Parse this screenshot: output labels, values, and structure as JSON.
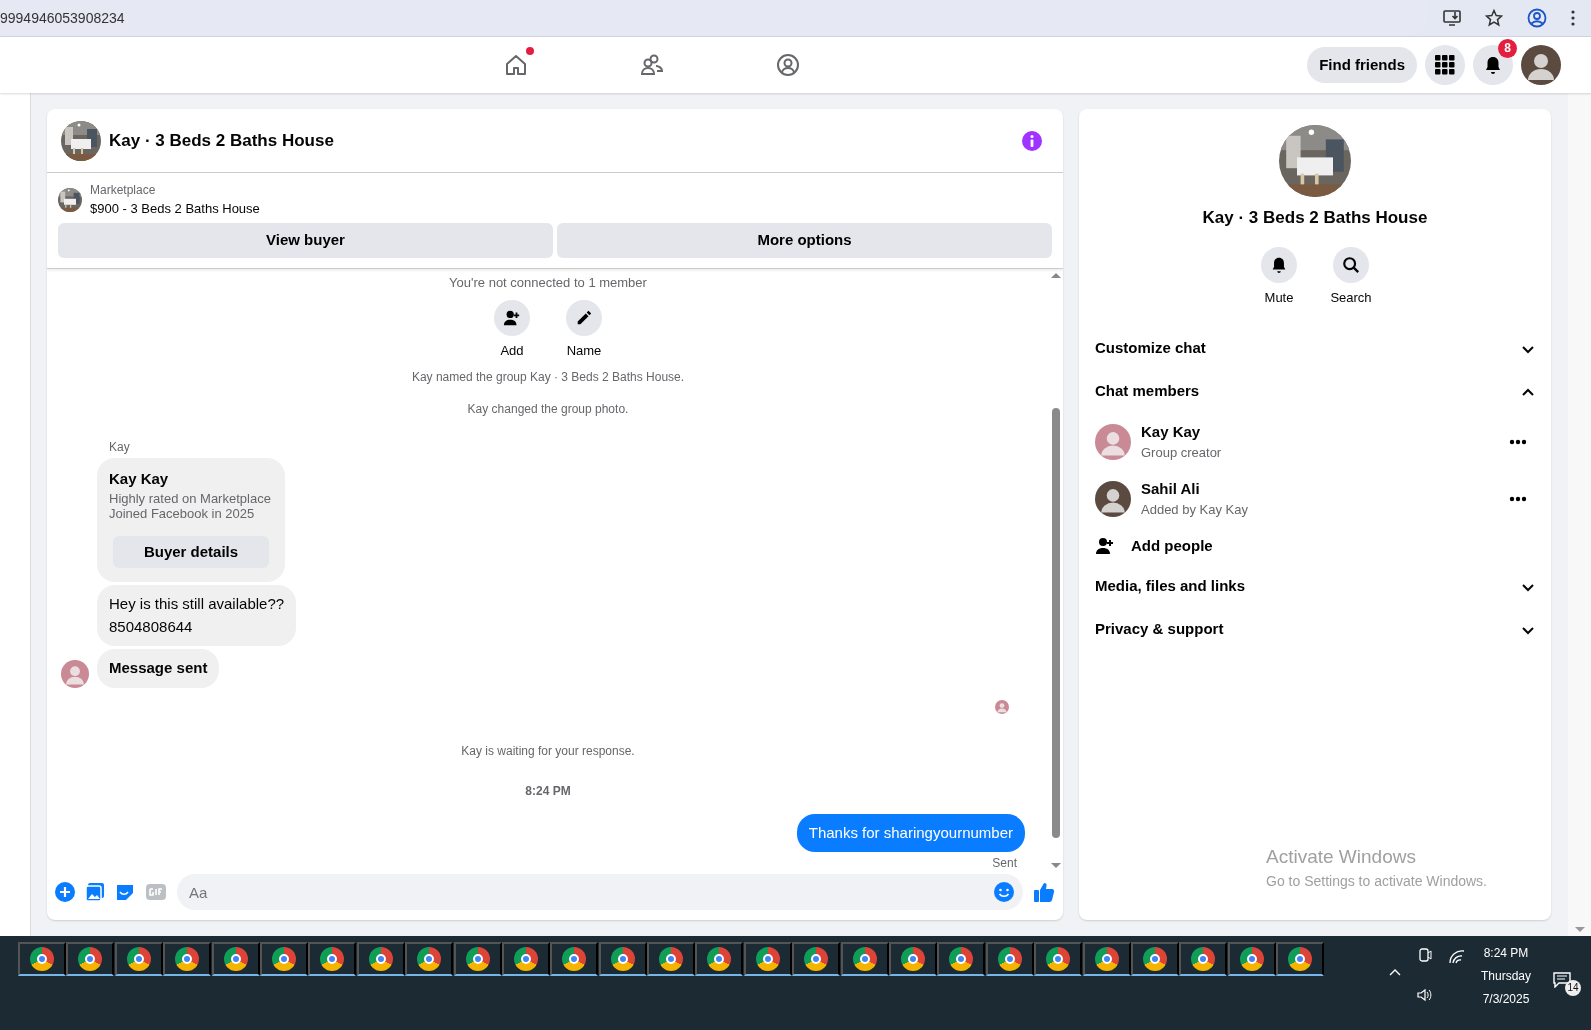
{
  "browser": {
    "url": "9994946053908234"
  },
  "nav": {
    "tabs": [
      {
        "kind": "home",
        "notification_dot": true
      },
      {
        "kind": "friends",
        "notification_dot": false
      },
      {
        "kind": "groups",
        "notification_dot": false
      }
    ],
    "find_friends": "Find friends",
    "notifications_count": "8"
  },
  "chat": {
    "title": "Kay · 3 Beds 2 Baths House",
    "listing": {
      "source": "Marketplace",
      "title": "$900 - 3 Beds 2 Baths House"
    },
    "buttons": [
      "View buyer",
      "More options"
    ],
    "notice": "You're not connected to 1 member",
    "actions": [
      {
        "kind": "add",
        "label": "Add"
      },
      {
        "kind": "name",
        "label": "Name"
      }
    ],
    "messages": [
      {
        "kind": "system",
        "text": "Kay named the group Kay · 3 Beds 2 Baths House."
      },
      {
        "kind": "system",
        "text": "Kay changed the group photo."
      },
      {
        "kind": "sender",
        "text": "Kay"
      },
      {
        "kind": "profile_card",
        "name": "Kay Kay",
        "lines": [
          "Highly rated on Marketplace",
          "Joined Facebook in 2025"
        ],
        "button": "Buyer details"
      },
      {
        "kind": "incoming",
        "text": "Hey is this still available??\n8504808644",
        "avatar": false
      },
      {
        "kind": "incoming",
        "text": "Message sent",
        "avatar": true
      },
      {
        "kind": "read_receipt"
      },
      {
        "kind": "system",
        "text": "Kay is waiting for your response."
      },
      {
        "kind": "timestamp",
        "text": "8:24 PM"
      },
      {
        "kind": "outgoing",
        "text": "Thanks for sharingyournumber",
        "status": "Sent"
      }
    ],
    "composer": {
      "placeholder": "Aa"
    }
  },
  "details": {
    "title": "Kay · 3 Beds 2 Baths House",
    "actions": [
      {
        "kind": "mute",
        "label": "Mute"
      },
      {
        "kind": "search",
        "label": "Search"
      }
    ],
    "sections": [
      {
        "label": "Customize chat",
        "expanded": false
      },
      {
        "label": "Chat members",
        "expanded": true,
        "members": [
          {
            "name": "Kay Kay",
            "role": "Group creator"
          },
          {
            "name": "Sahil Ali",
            "role": "Added by Kay Kay"
          }
        ],
        "add_label": "Add people"
      },
      {
        "label": "Media, files and links",
        "expanded": false
      },
      {
        "label": "Privacy & support",
        "expanded": false
      }
    ]
  },
  "activation": {
    "title": "Activate Windows",
    "subtitle": "Go to Settings to activate Windows."
  },
  "taskbar": {
    "apps": [
      {
        "kind": "browser"
      },
      {
        "kind": "browser"
      },
      {
        "kind": "browser"
      },
      {
        "kind": "browser"
      },
      {
        "kind": "browser"
      },
      {
        "kind": "browser"
      },
      {
        "kind": "browser"
      },
      {
        "kind": "browser"
      },
      {
        "kind": "browser"
      },
      {
        "kind": "browser"
      },
      {
        "kind": "browser"
      },
      {
        "kind": "browser"
      },
      {
        "kind": "browser"
      },
      {
        "kind": "browser"
      },
      {
        "kind": "browser"
      },
      {
        "kind": "browser"
      },
      {
        "kind": "browser"
      },
      {
        "kind": "browser"
      },
      {
        "kind": "browser"
      },
      {
        "kind": "browser"
      },
      {
        "kind": "browser"
      },
      {
        "kind": "browser"
      },
      {
        "kind": "browser"
      },
      {
        "kind": "browser"
      },
      {
        "kind": "browser"
      },
      {
        "kind": "browser"
      },
      {
        "kind": "browser"
      }
    ],
    "time": "8:24 PM",
    "day": "Thursday",
    "date": "7/3/2025",
    "notifications": "14"
  }
}
